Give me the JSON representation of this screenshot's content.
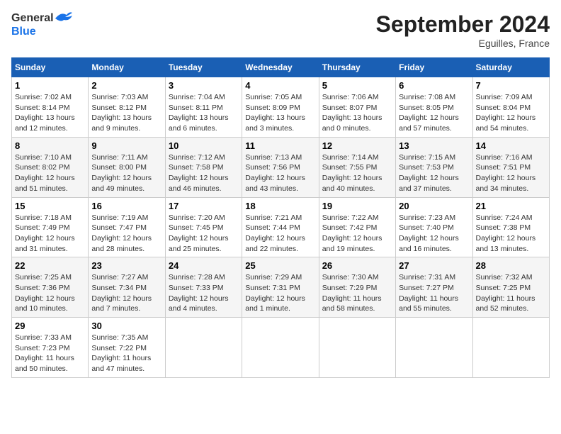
{
  "logo": {
    "text_general": "General",
    "text_blue": "Blue"
  },
  "title": "September 2024",
  "location": "Eguilles, France",
  "days_of_week": [
    "Sunday",
    "Monday",
    "Tuesday",
    "Wednesday",
    "Thursday",
    "Friday",
    "Saturday"
  ],
  "weeks": [
    [
      {
        "day": "1",
        "sunrise": "Sunrise: 7:02 AM",
        "sunset": "Sunset: 8:14 PM",
        "daylight": "Daylight: 13 hours and 12 minutes."
      },
      {
        "day": "2",
        "sunrise": "Sunrise: 7:03 AM",
        "sunset": "Sunset: 8:12 PM",
        "daylight": "Daylight: 13 hours and 9 minutes."
      },
      {
        "day": "3",
        "sunrise": "Sunrise: 7:04 AM",
        "sunset": "Sunset: 8:11 PM",
        "daylight": "Daylight: 13 hours and 6 minutes."
      },
      {
        "day": "4",
        "sunrise": "Sunrise: 7:05 AM",
        "sunset": "Sunset: 8:09 PM",
        "daylight": "Daylight: 13 hours and 3 minutes."
      },
      {
        "day": "5",
        "sunrise": "Sunrise: 7:06 AM",
        "sunset": "Sunset: 8:07 PM",
        "daylight": "Daylight: 13 hours and 0 minutes."
      },
      {
        "day": "6",
        "sunrise": "Sunrise: 7:08 AM",
        "sunset": "Sunset: 8:05 PM",
        "daylight": "Daylight: 12 hours and 57 minutes."
      },
      {
        "day": "7",
        "sunrise": "Sunrise: 7:09 AM",
        "sunset": "Sunset: 8:04 PM",
        "daylight": "Daylight: 12 hours and 54 minutes."
      }
    ],
    [
      {
        "day": "8",
        "sunrise": "Sunrise: 7:10 AM",
        "sunset": "Sunset: 8:02 PM",
        "daylight": "Daylight: 12 hours and 51 minutes."
      },
      {
        "day": "9",
        "sunrise": "Sunrise: 7:11 AM",
        "sunset": "Sunset: 8:00 PM",
        "daylight": "Daylight: 12 hours and 49 minutes."
      },
      {
        "day": "10",
        "sunrise": "Sunrise: 7:12 AM",
        "sunset": "Sunset: 7:58 PM",
        "daylight": "Daylight: 12 hours and 46 minutes."
      },
      {
        "day": "11",
        "sunrise": "Sunrise: 7:13 AM",
        "sunset": "Sunset: 7:56 PM",
        "daylight": "Daylight: 12 hours and 43 minutes."
      },
      {
        "day": "12",
        "sunrise": "Sunrise: 7:14 AM",
        "sunset": "Sunset: 7:55 PM",
        "daylight": "Daylight: 12 hours and 40 minutes."
      },
      {
        "day": "13",
        "sunrise": "Sunrise: 7:15 AM",
        "sunset": "Sunset: 7:53 PM",
        "daylight": "Daylight: 12 hours and 37 minutes."
      },
      {
        "day": "14",
        "sunrise": "Sunrise: 7:16 AM",
        "sunset": "Sunset: 7:51 PM",
        "daylight": "Daylight: 12 hours and 34 minutes."
      }
    ],
    [
      {
        "day": "15",
        "sunrise": "Sunrise: 7:18 AM",
        "sunset": "Sunset: 7:49 PM",
        "daylight": "Daylight: 12 hours and 31 minutes."
      },
      {
        "day": "16",
        "sunrise": "Sunrise: 7:19 AM",
        "sunset": "Sunset: 7:47 PM",
        "daylight": "Daylight: 12 hours and 28 minutes."
      },
      {
        "day": "17",
        "sunrise": "Sunrise: 7:20 AM",
        "sunset": "Sunset: 7:45 PM",
        "daylight": "Daylight: 12 hours and 25 minutes."
      },
      {
        "day": "18",
        "sunrise": "Sunrise: 7:21 AM",
        "sunset": "Sunset: 7:44 PM",
        "daylight": "Daylight: 12 hours and 22 minutes."
      },
      {
        "day": "19",
        "sunrise": "Sunrise: 7:22 AM",
        "sunset": "Sunset: 7:42 PM",
        "daylight": "Daylight: 12 hours and 19 minutes."
      },
      {
        "day": "20",
        "sunrise": "Sunrise: 7:23 AM",
        "sunset": "Sunset: 7:40 PM",
        "daylight": "Daylight: 12 hours and 16 minutes."
      },
      {
        "day": "21",
        "sunrise": "Sunrise: 7:24 AM",
        "sunset": "Sunset: 7:38 PM",
        "daylight": "Daylight: 12 hours and 13 minutes."
      }
    ],
    [
      {
        "day": "22",
        "sunrise": "Sunrise: 7:25 AM",
        "sunset": "Sunset: 7:36 PM",
        "daylight": "Daylight: 12 hours and 10 minutes."
      },
      {
        "day": "23",
        "sunrise": "Sunrise: 7:27 AM",
        "sunset": "Sunset: 7:34 PM",
        "daylight": "Daylight: 12 hours and 7 minutes."
      },
      {
        "day": "24",
        "sunrise": "Sunrise: 7:28 AM",
        "sunset": "Sunset: 7:33 PM",
        "daylight": "Daylight: 12 hours and 4 minutes."
      },
      {
        "day": "25",
        "sunrise": "Sunrise: 7:29 AM",
        "sunset": "Sunset: 7:31 PM",
        "daylight": "Daylight: 12 hours and 1 minute."
      },
      {
        "day": "26",
        "sunrise": "Sunrise: 7:30 AM",
        "sunset": "Sunset: 7:29 PM",
        "daylight": "Daylight: 11 hours and 58 minutes."
      },
      {
        "day": "27",
        "sunrise": "Sunrise: 7:31 AM",
        "sunset": "Sunset: 7:27 PM",
        "daylight": "Daylight: 11 hours and 55 minutes."
      },
      {
        "day": "28",
        "sunrise": "Sunrise: 7:32 AM",
        "sunset": "Sunset: 7:25 PM",
        "daylight": "Daylight: 11 hours and 52 minutes."
      }
    ],
    [
      {
        "day": "29",
        "sunrise": "Sunrise: 7:33 AM",
        "sunset": "Sunset: 7:23 PM",
        "daylight": "Daylight: 11 hours and 50 minutes."
      },
      {
        "day": "30",
        "sunrise": "Sunrise: 7:35 AM",
        "sunset": "Sunset: 7:22 PM",
        "daylight": "Daylight: 11 hours and 47 minutes."
      },
      null,
      null,
      null,
      null,
      null
    ]
  ]
}
